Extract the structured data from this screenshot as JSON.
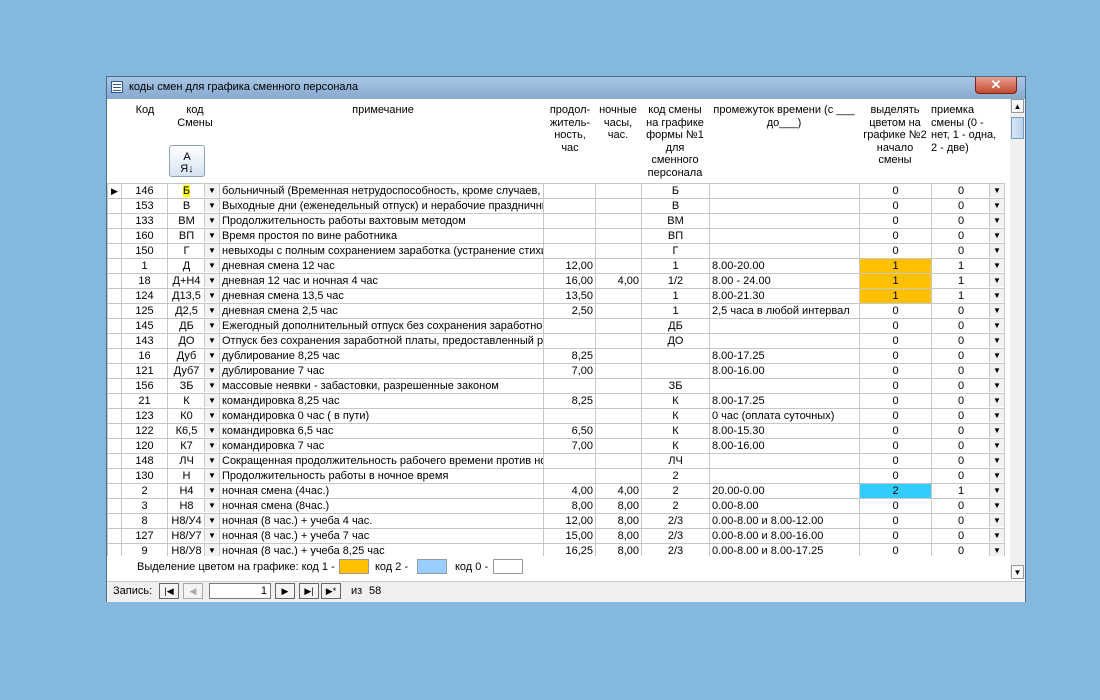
{
  "window": {
    "title": "коды смен для графика сменного персонала",
    "close_label": "✕"
  },
  "headers": {
    "kod": "Код",
    "kod_smeny": "код Смены",
    "primechanie": "примечание",
    "prodolzhitelnost": "продол-житель-ность, час",
    "nochnye": "ночные часы, час.",
    "kod_grafik": "код смены на графике формы №1 для сменного персонала",
    "promezhutok": "промежуток времени (с ___ до___)",
    "vydelyat": "выделять цветом на графике №2 начало смены",
    "priemka": "приемка смены (0 - нет, 1 - одна, 2 - две)",
    "sort_icon": "sort-ascending-icon"
  },
  "rows": [
    {
      "kod": "146",
      "smena": "Б",
      "prim": "больничный (Временная нетрудоспособность, кроме случаев, п",
      "dlit": "",
      "noch": "",
      "graf": "Б",
      "prom": "",
      "vyd": "0",
      "pri": "0",
      "current": true
    },
    {
      "kod": "153",
      "smena": "В",
      "prim": "Выходные дни (еженедельный отпуск) и нерабочие праздничны",
      "dlit": "",
      "noch": "",
      "graf": "В",
      "prom": "",
      "vyd": "0",
      "pri": "0"
    },
    {
      "kod": "133",
      "smena": "ВМ",
      "prim": "Продолжительность работы вахтовым методом",
      "dlit": "",
      "noch": "",
      "graf": "ВМ",
      "prom": "",
      "vyd": "0",
      "pri": "0"
    },
    {
      "kod": "160",
      "smena": "ВП",
      "prim": "Время простоя по вине работника",
      "dlit": "",
      "noch": "",
      "graf": "ВП",
      "prom": "",
      "vyd": "0",
      "pri": "0"
    },
    {
      "kod": "150",
      "smena": "Г",
      "prim": "невыходы с полным сохранением заработка (устранение стихи",
      "dlit": "",
      "noch": "",
      "graf": "Г",
      "prom": "",
      "vyd": "0",
      "pri": "0"
    },
    {
      "kod": "1",
      "smena": "Д",
      "prim": "дневная смена 12 час",
      "dlit": "12,00",
      "noch": "",
      "graf": "1",
      "prom": "8.00-20.00",
      "vyd": "1",
      "pri": "1",
      "color": "orange"
    },
    {
      "kod": "18",
      "smena": "Д+Н4",
      "prim": "дневная 12 час и ночная 4 час",
      "dlit": "16,00",
      "noch": "4,00",
      "graf": "1/2",
      "prom": "8.00 - 24.00",
      "vyd": "1",
      "pri": "1",
      "color": "orange"
    },
    {
      "kod": "124",
      "smena": "Д13,5",
      "prim": "дневная смена 13,5 час",
      "dlit": "13,50",
      "noch": "",
      "graf": "1",
      "prom": "8.00-21.30",
      "vyd": "1",
      "pri": "1",
      "color": "orange"
    },
    {
      "kod": "125",
      "smena": "Д2,5",
      "prim": "дневная смена 2,5 час",
      "dlit": "2,50",
      "noch": "",
      "graf": "1",
      "prom": "2,5 часа в любой интервал",
      "vyd": "0",
      "pri": "0"
    },
    {
      "kod": "145",
      "smena": "ДБ",
      "prim": "Ежегодный дополнительный отпуск без сохранения заработно",
      "dlit": "",
      "noch": "",
      "graf": "ДБ",
      "prom": "",
      "vyd": "0",
      "pri": "0"
    },
    {
      "kod": "143",
      "smena": "ДО",
      "prim": "Отпуск без сохранения заработной платы, предоставленный р",
      "dlit": "",
      "noch": "",
      "graf": "ДО",
      "prom": "",
      "vyd": "0",
      "pri": "0"
    },
    {
      "kod": "16",
      "smena": "Дуб",
      "prim": "дублирование 8,25 час",
      "dlit": "8,25",
      "noch": "",
      "graf": "",
      "prom": "8.00-17.25",
      "vyd": "0",
      "pri": "0"
    },
    {
      "kod": "121",
      "smena": "Дуб7",
      "prim": "дублирование 7 час",
      "dlit": "7,00",
      "noch": "",
      "graf": "",
      "prom": "8.00-16.00",
      "vyd": "0",
      "pri": "0"
    },
    {
      "kod": "156",
      "smena": "ЗБ",
      "prim": "массовые неявки - забастовки, разрешенные законом",
      "dlit": "",
      "noch": "",
      "graf": "ЗБ",
      "prom": "",
      "vyd": "0",
      "pri": "0"
    },
    {
      "kod": "21",
      "smena": "К",
      "prim": "командировка 8,25 час",
      "dlit": "8,25",
      "noch": "",
      "graf": "К",
      "prom": "8.00-17.25",
      "vyd": "0",
      "pri": "0"
    },
    {
      "kod": "123",
      "smena": "К0",
      "prim": "командировка 0 час ( в пути)",
      "dlit": "",
      "noch": "",
      "graf": "К",
      "prom": "0 час (оплата суточных)",
      "vyd": "0",
      "pri": "0"
    },
    {
      "kod": "122",
      "smena": "К6,5",
      "prim": "командировка 6,5 час",
      "dlit": "6,50",
      "noch": "",
      "graf": "К",
      "prom": "8.00-15.30",
      "vyd": "0",
      "pri": "0"
    },
    {
      "kod": "120",
      "smena": "К7",
      "prim": "командировка 7 час",
      "dlit": "7,00",
      "noch": "",
      "graf": "К",
      "prom": "8.00-16.00",
      "vyd": "0",
      "pri": "0"
    },
    {
      "kod": "148",
      "smena": "ЛЧ",
      "prim": "Сокращенная продолжительность рабочего времени против но",
      "dlit": "",
      "noch": "",
      "graf": "ЛЧ",
      "prom": "",
      "vyd": "0",
      "pri": "0"
    },
    {
      "kod": "130",
      "smena": "Н",
      "prim": "Продолжительность работы в ночное время",
      "dlit": "",
      "noch": "",
      "graf": "2",
      "prom": "",
      "vyd": "0",
      "pri": "0"
    },
    {
      "kod": "2",
      "smena": "Н4",
      "prim": "ночная смена (4час.)",
      "dlit": "4,00",
      "noch": "4,00",
      "graf": "2",
      "prom": "20.00-0.00",
      "vyd": "2",
      "pri": "1",
      "color": "cyan"
    },
    {
      "kod": "3",
      "smena": "Н8",
      "prim": "ночная смена (8час.)",
      "dlit": "8,00",
      "noch": "8,00",
      "graf": "2",
      "prom": "0.00-8.00",
      "vyd": "0",
      "pri": "0"
    },
    {
      "kod": "8",
      "smena": "Н8/У4",
      "prim": "ночная (8 час.) + учеба 4 час.",
      "dlit": "12,00",
      "noch": "8,00",
      "graf": "2/3",
      "prom": "0.00-8.00 и 8.00-12.00",
      "vyd": "0",
      "pri": "0"
    },
    {
      "kod": "127",
      "smena": "Н8/У7",
      "prim": "ночная (8 час.) + учеба 7 час",
      "dlit": "15,00",
      "noch": "8,00",
      "graf": "2/3",
      "prom": "0.00-8.00 и 8.00-16.00",
      "vyd": "0",
      "pri": "0"
    },
    {
      "kod": "9",
      "smena": "Н8/У8",
      "prim": "ночная (8 час.) + учеба 8,25 час",
      "dlit": "16,25",
      "noch": "8,00",
      "graf": "2/3",
      "prom": "0.00-8.00 и 8.00-17.25",
      "vyd": "0",
      "pri": "0"
    }
  ],
  "legend": {
    "label": "Выделение цветом на графике: код 1 -",
    "kod2": "код 2 -",
    "kod0": "код 0 -",
    "color1": "#ffc000",
    "color2": "#99ccff",
    "color0": "#ffffff"
  },
  "record_nav": {
    "label": "Запись:",
    "current": "1",
    "of_label": "из",
    "total": "58"
  },
  "colors": {
    "orange": "#ffc000",
    "cyan": "#33ccff",
    "selection": "#ffff00",
    "desktop": "#85b8dd"
  }
}
